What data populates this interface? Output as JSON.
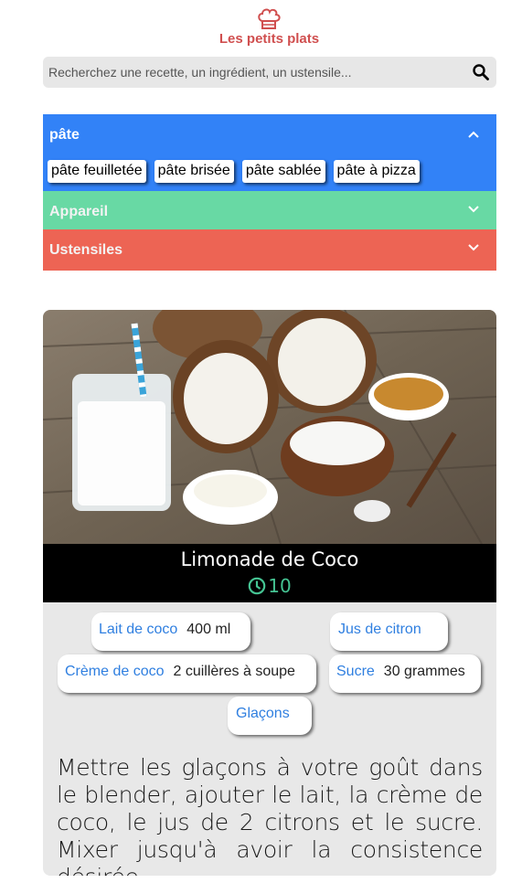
{
  "header": {
    "logo_icon": "chef-hat-icon",
    "title": "Les petits plats"
  },
  "search": {
    "placeholder": "Recherchez une recette, un ingrédient, un ustensile...",
    "icon": "search-icon"
  },
  "filters": [
    {
      "title": "pâte",
      "color": "#3282f7",
      "expanded": true,
      "tags": [
        "pâte feuilletée",
        "pâte brisée",
        "pâte sablée",
        "pâte à pizza"
      ]
    },
    {
      "title": "Appareil",
      "color": "#68d9a4",
      "expanded": false
    },
    {
      "title": "Ustensiles",
      "color": "#ed6454",
      "expanded": false
    }
  ],
  "recipe": {
    "title": "Limonade de Coco",
    "time": "10",
    "time_icon": "clock-icon",
    "ingredients": [
      {
        "name": "Lait de coco",
        "quantity": "400 ml"
      },
      {
        "name": "Jus de citron",
        "quantity": ""
      },
      {
        "name": "Crème de coco",
        "quantity": "2 cuillères à soupe"
      },
      {
        "name": "Sucre",
        "quantity": "30 grammes"
      },
      {
        "name": "Glaçons",
        "quantity": ""
      }
    ],
    "description": "Mettre les glaçons à votre goût dans le blender, ajouter le lait, la crème de coco, le jus de 2 citrons et le sucre. Mixer jusqu'à avoir la consistence désirée..."
  },
  "colors": {
    "brand": "#d04f4f",
    "ingredient_name": "#2f7fe0",
    "time": "#45c493"
  }
}
